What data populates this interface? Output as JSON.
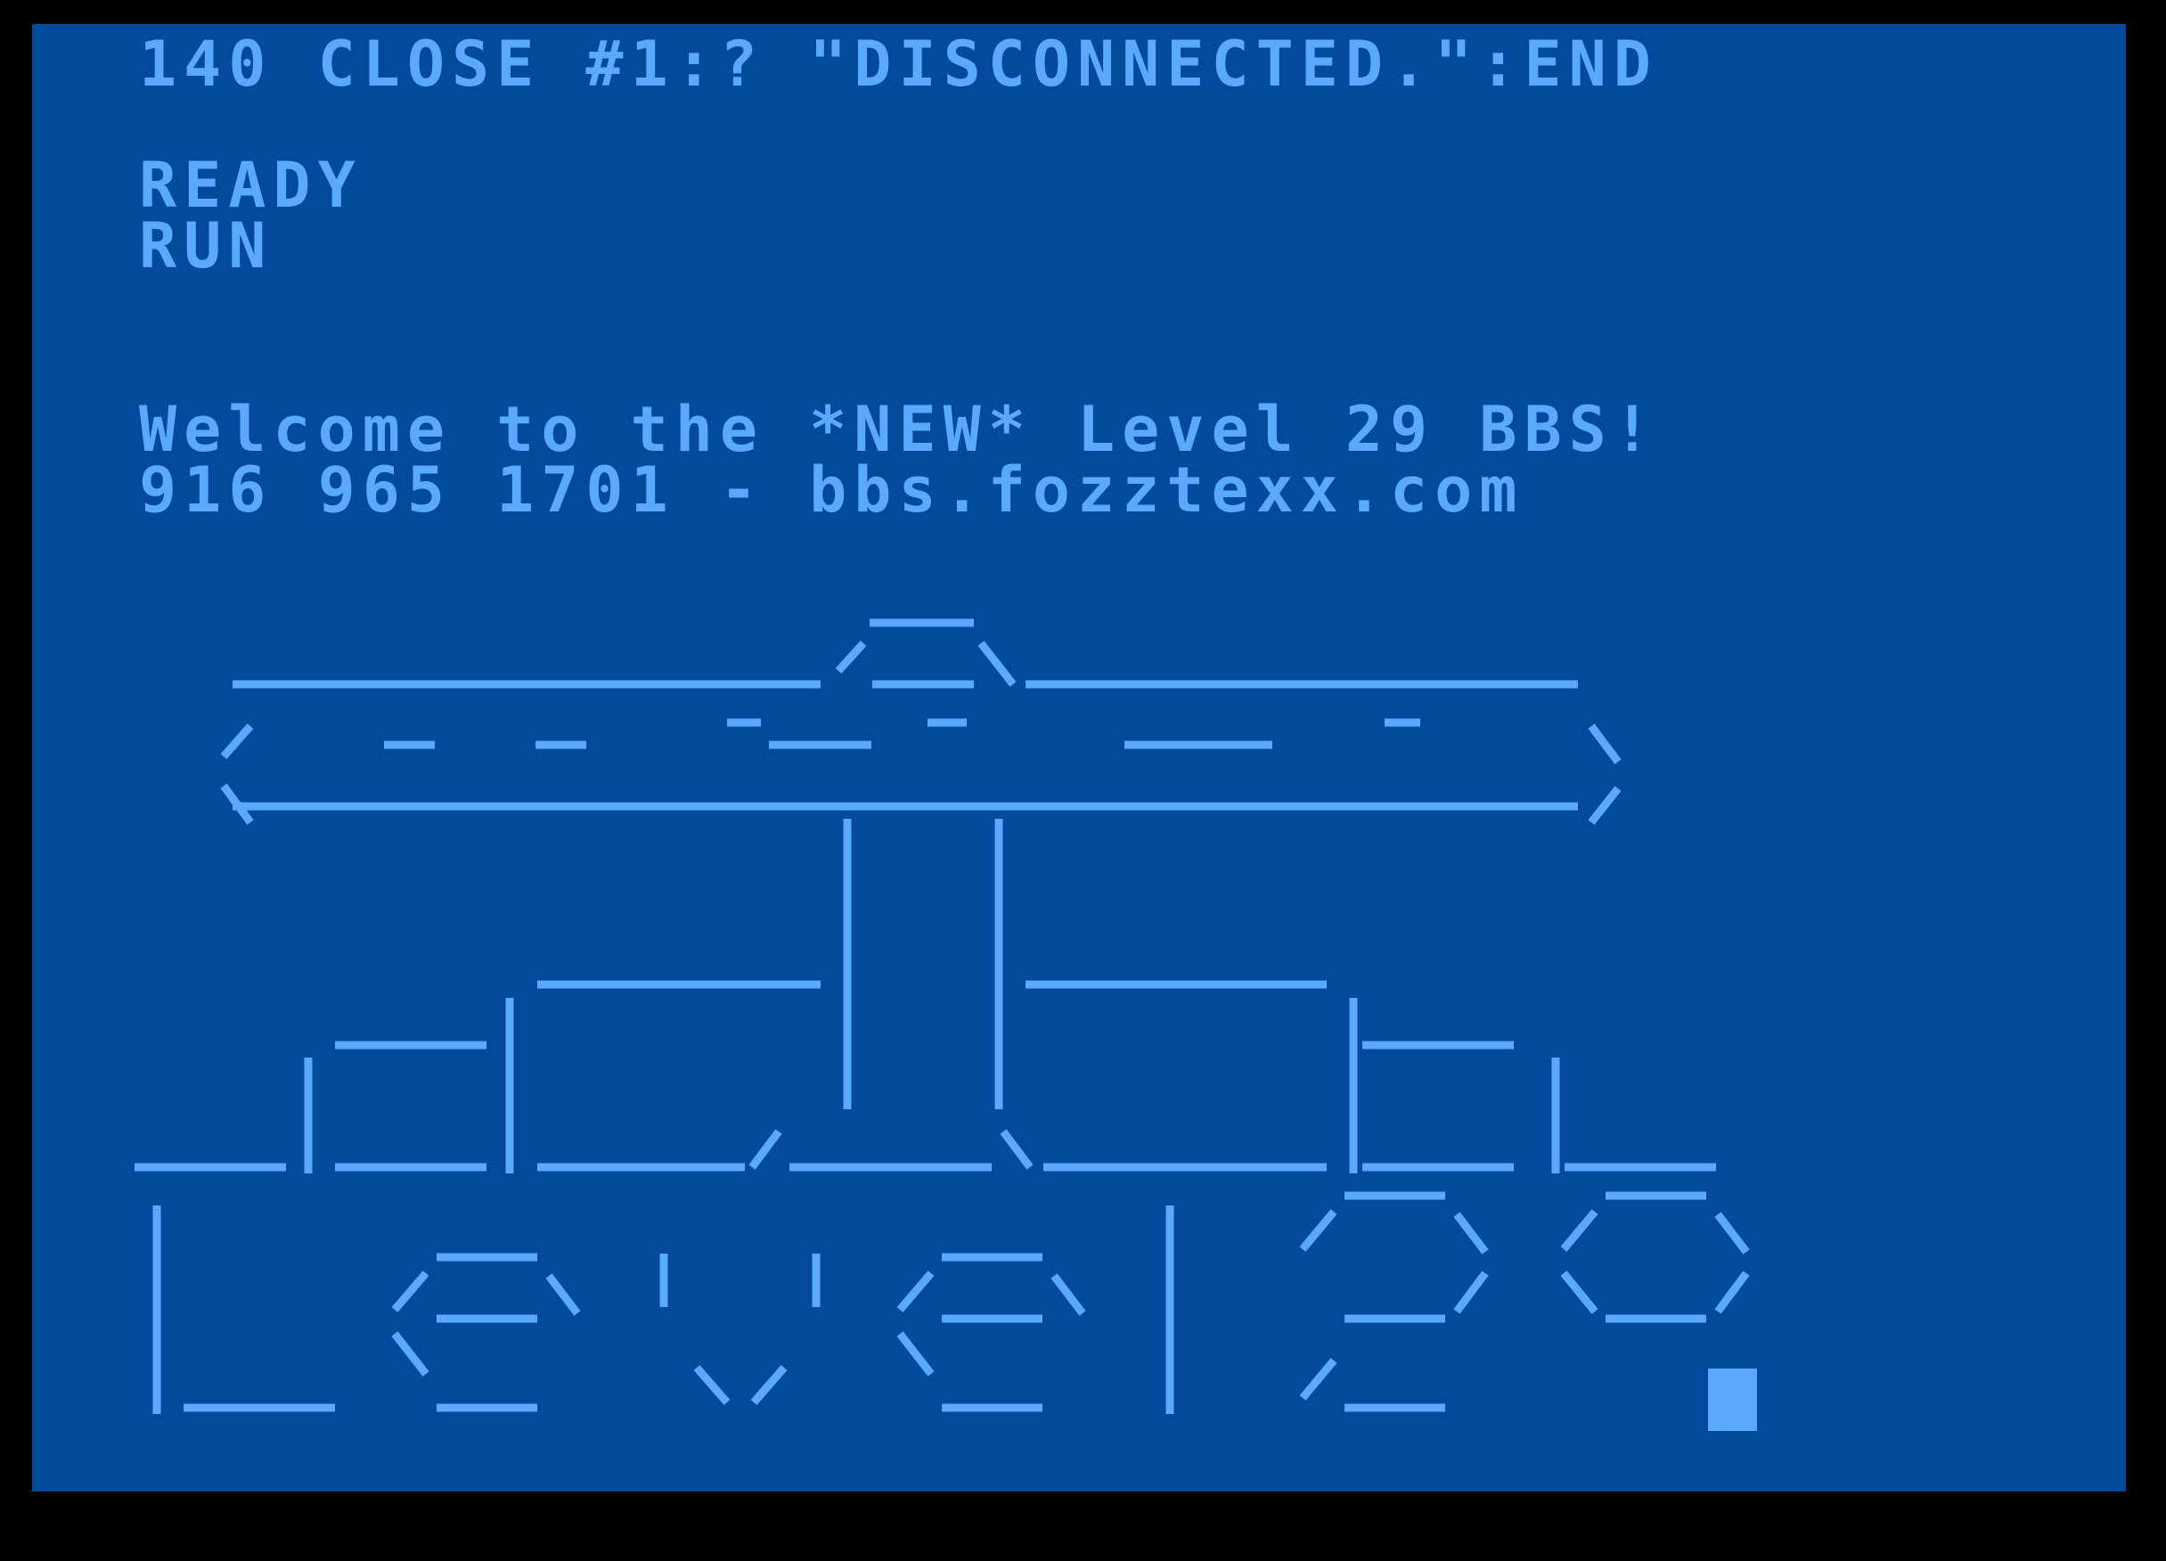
{
  "terminal": {
    "listing_line": "140 CLOSE #1:? \"DISCONNECTED.\":END",
    "ready_prompt": "READY",
    "run_command": "RUN",
    "welcome_line": "Welcome to the *NEW* Level 29 BBS!",
    "contact_line": "916 965 1701 - bbs.fozztexx.com"
  },
  "ascii_art": {
    "icon": "biplane-ascii-art",
    "logo_text": "Level29"
  },
  "colors": {
    "border": "#000000",
    "background": "#034a9d",
    "foreground": "#5ba8ff"
  }
}
